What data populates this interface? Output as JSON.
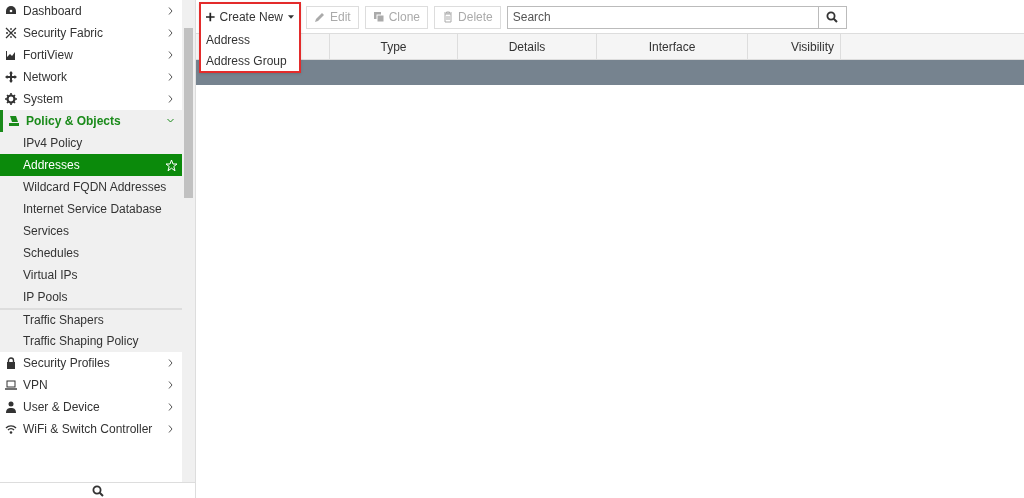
{
  "sidebar": {
    "items": [
      {
        "label": "Dashboard",
        "expanded": false
      },
      {
        "label": "Security Fabric",
        "expanded": false
      },
      {
        "label": "FortiView",
        "expanded": false
      },
      {
        "label": "Network",
        "expanded": false
      },
      {
        "label": "System",
        "expanded": false
      },
      {
        "label": "Policy & Objects",
        "expanded": true,
        "children": [
          {
            "label": "IPv4 Policy",
            "selected": false,
            "starred": false,
            "divider_before": false
          },
          {
            "label": "Addresses",
            "selected": true,
            "starred": true,
            "divider_before": false
          },
          {
            "label": "Wildcard FQDN Addresses",
            "selected": false,
            "starred": false,
            "divider_before": false
          },
          {
            "label": "Internet Service Database",
            "selected": false,
            "starred": false,
            "divider_before": false
          },
          {
            "label": "Services",
            "selected": false,
            "starred": false,
            "divider_before": false
          },
          {
            "label": "Schedules",
            "selected": false,
            "starred": false,
            "divider_before": false
          },
          {
            "label": "Virtual IPs",
            "selected": false,
            "starred": false,
            "divider_before": false
          },
          {
            "label": "IP Pools",
            "selected": false,
            "starred": false,
            "divider_before": false
          },
          {
            "label": "Traffic Shapers",
            "selected": false,
            "starred": false,
            "divider_before": true
          },
          {
            "label": "Traffic Shaping Policy",
            "selected": false,
            "starred": false,
            "divider_before": false
          }
        ]
      },
      {
        "label": "Security Profiles",
        "expanded": false
      },
      {
        "label": "VPN",
        "expanded": false
      },
      {
        "label": "User & Device",
        "expanded": false
      },
      {
        "label": "WiFi & Switch Controller",
        "expanded": false
      }
    ]
  },
  "toolbar": {
    "create": {
      "label": "Create New",
      "expanded": true,
      "menu": [
        "Address",
        "Address Group"
      ]
    },
    "buttons": [
      {
        "label": "Edit",
        "disabled": true
      },
      {
        "label": "Clone",
        "disabled": true
      },
      {
        "label": "Delete",
        "disabled": true
      }
    ],
    "search": {
      "placeholder": "Search"
    }
  },
  "table": {
    "columns": [
      "Type",
      "Details",
      "Interface",
      "Visibility"
    ]
  }
}
